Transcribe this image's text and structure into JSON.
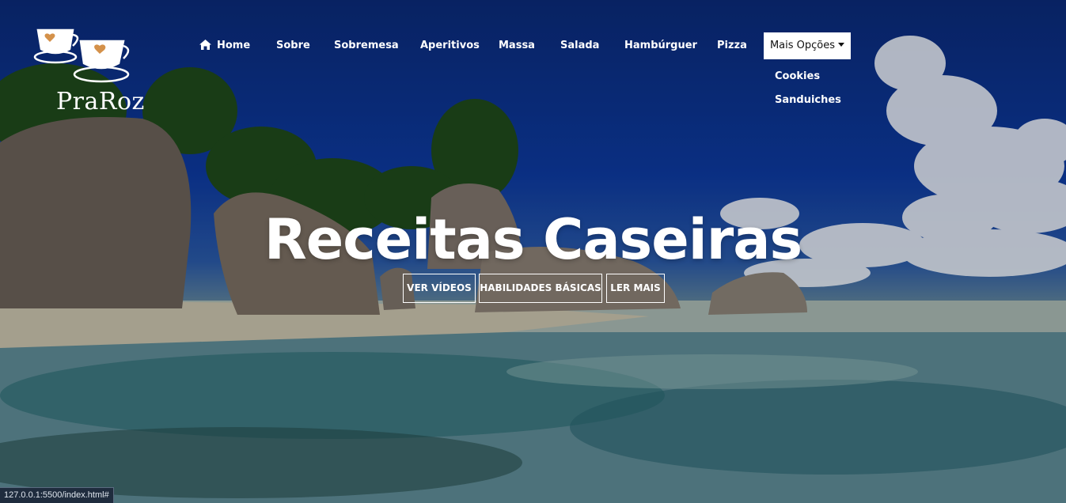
{
  "brand": {
    "name": "PraRoz"
  },
  "nav": {
    "items": [
      {
        "label": "Home",
        "icon": "home-icon"
      },
      {
        "label": "Sobre"
      },
      {
        "label": "Sobremesa"
      },
      {
        "label": "Aperitivos"
      },
      {
        "label": "Massa"
      },
      {
        "label": "Salada"
      },
      {
        "label": "Hambúrguer"
      },
      {
        "label": "Pizza"
      }
    ],
    "more": {
      "label": "Mais Opções",
      "icon": "caret-down-icon"
    },
    "dropdown": [
      {
        "label": "Cookies"
      },
      {
        "label": "Sanduiches"
      }
    ]
  },
  "hero": {
    "title": "Receitas Caseiras",
    "buttons": [
      {
        "label": "Ver vídeos"
      },
      {
        "label": "Habilidades básicas"
      },
      {
        "label": "Ler mais"
      }
    ]
  },
  "statusbar": {
    "url": "127.0.0.1:5500/index.html#"
  },
  "colors": {
    "sky": "#0d3aa0",
    "button_bg": "#ffffff",
    "statusbar": "#1f2c3e"
  }
}
